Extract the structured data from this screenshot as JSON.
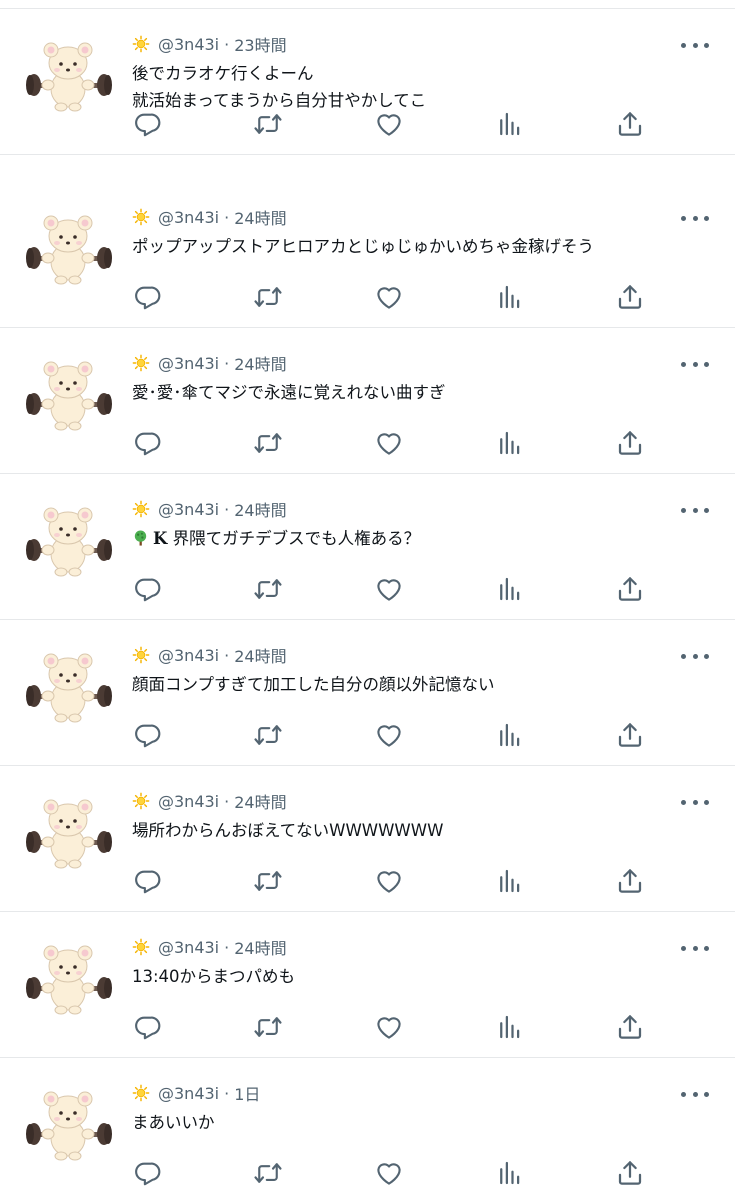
{
  "timeline": {
    "tweets": [
      {
        "handle": "@3n43i",
        "separator": "·",
        "time": "23時間",
        "lines": [
          "後でカラオケ行くよーん",
          "就活始まってまうから自分甘やかしてこ"
        ]
      },
      {
        "handle": "@3n43i",
        "separator": "·",
        "time": "24時間",
        "lines": [
          "ポップアップストアヒロアカとじゅじゅかいめちゃ金稼げそう"
        ]
      },
      {
        "handle": "@3n43i",
        "separator": "·",
        "time": "24時間",
        "lines": [
          "愛･愛･傘てマジで永遠に覚えれない曲すぎ"
        ]
      },
      {
        "handle": "@3n43i",
        "separator": "·",
        "time": "24時間",
        "prefix_icon": "tree-emoji-icon",
        "prefix_tag": "K",
        "lines": [
          " 界隈てガチデブスでも人権ある？"
        ]
      },
      {
        "handle": "@3n43i",
        "separator": "·",
        "time": "24時間",
        "lines": [
          "顔面コンプすぎて加工した自分の顔以外記憶ない"
        ]
      },
      {
        "handle": "@3n43i",
        "separator": "·",
        "time": "24時間",
        "lines": [
          "場所わからんおぼえてないWWWWWWW"
        ]
      },
      {
        "handle": "@3n43i",
        "separator": "·",
        "time": "24時間",
        "lines": [
          "13:40からまつパめも"
        ]
      },
      {
        "handle": "@3n43i",
        "separator": "·",
        "time": "1日",
        "lines": [
          "まあいいか"
        ]
      }
    ]
  },
  "icons": {
    "profile": "sun-emoji-icon",
    "avatar": "bear-lifting-barbell-avatar",
    "more": "more-dots-icon",
    "reply": "reply-icon",
    "retweet": "retweet-icon",
    "like": "heart-icon",
    "views": "views-bars-icon",
    "share": "share-icon"
  },
  "colors": {
    "icon_gray": "#536471",
    "text": "#0f1419",
    "divider": "#e6e8ea",
    "sun": "#f5b400"
  }
}
